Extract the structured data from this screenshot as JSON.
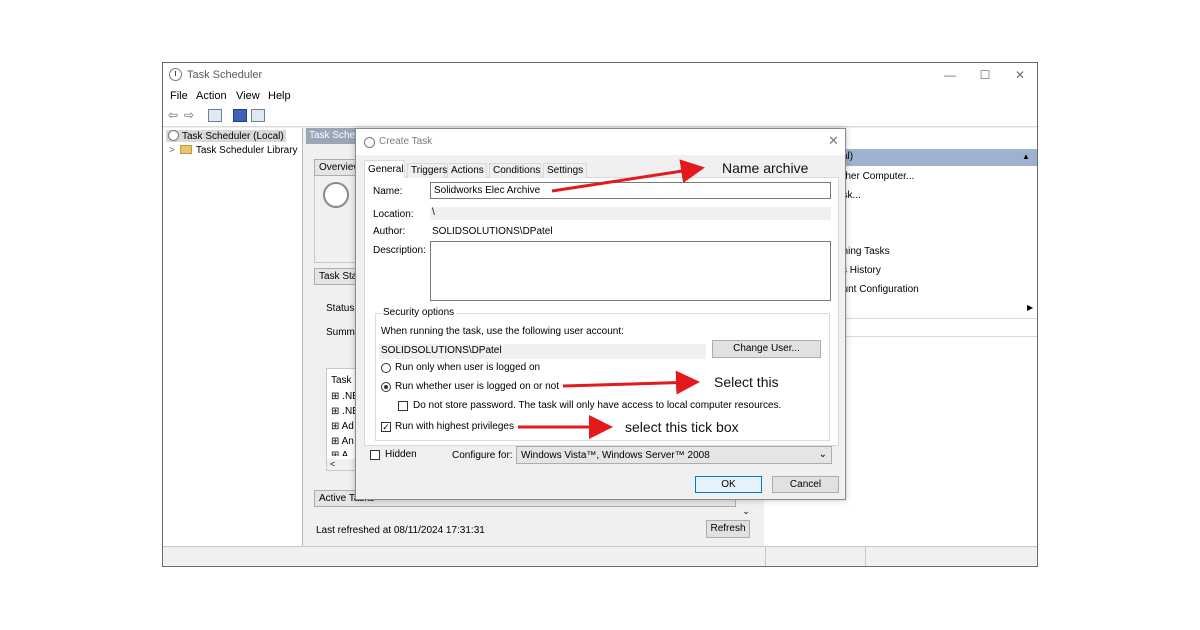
{
  "window": {
    "title": "Task Scheduler",
    "controls": {
      "minimize": "—",
      "maximize": "☐",
      "close": "✕"
    }
  },
  "menu": [
    "File",
    "Action",
    "View",
    "Help"
  ],
  "tree": {
    "root": "Task Scheduler (Local)",
    "library": "Task Scheduler Library",
    "expand_glyph": ">"
  },
  "center": {
    "header": "Task Schedul",
    "overview": "Overview",
    "task_status": "Task Stat",
    "status": "Status",
    "summary": "Summ",
    "task_list_header": "Task N",
    "task_items": [
      ".NE",
      ".NE",
      "Ad",
      "An",
      "A"
    ],
    "active_tasks": "Active Tasks",
    "last_refreshed": "Last refreshed at 08/11/2024 17:31:31",
    "refresh": "Refresh"
  },
  "actions_pane": {
    "header": "cal)",
    "items": [
      "other Computer...",
      "ask...",
      "nning Tasks",
      "ks History",
      "ount Configuration"
    ]
  },
  "dialog": {
    "title": "Create Task",
    "close": "✕",
    "tabs": [
      "General",
      "Triggers",
      "Actions",
      "Conditions",
      "Settings"
    ],
    "labels": {
      "name": "Name:",
      "location": "Location:",
      "author": "Author:",
      "description": "Description:"
    },
    "values": {
      "name": "Solidworks Elec Archive",
      "location": "\\",
      "author": "SOLIDSOLUTIONS\\DPatel",
      "description": ""
    },
    "security": {
      "title": "Security options",
      "prompt": "When running the task, use the following user account:",
      "account": "SOLIDSOLUTIONS\\DPatel",
      "change_user": "Change User...",
      "radio_logged_on": "Run only when user is logged on",
      "radio_whether": "Run whether user is logged on or not",
      "radio_selected": "whether",
      "no_store_password": "Do not store password.  The task will only have access to local computer resources.",
      "no_store_password_checked": false,
      "highest_privileges": "Run with highest privileges",
      "highest_privileges_checked": true
    },
    "hidden": "Hidden",
    "hidden_checked": false,
    "configure_for_label": "Configure for:",
    "configure_for_value": "Windows Vista™, Windows Server™ 2008",
    "ok": "OK",
    "cancel": "Cancel"
  },
  "annotations": {
    "name_archive": "Name archive",
    "select_this": "Select this",
    "select_tick_box": "select this tick box",
    "arrow_color": "#e3191c"
  }
}
